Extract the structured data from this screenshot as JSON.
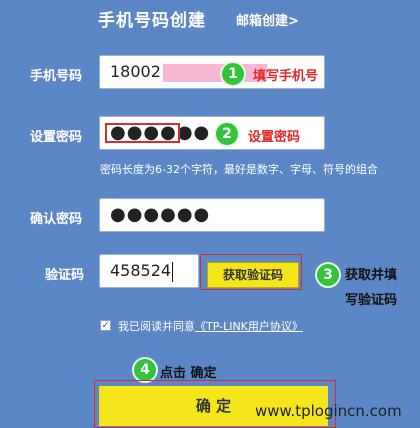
{
  "header": {
    "title": "手机号码创建",
    "alt_link": "邮箱创建>"
  },
  "phone": {
    "label": "手机号码",
    "value": "18002",
    "step": "1",
    "annotation": "填写手机号"
  },
  "password": {
    "label": "设置密码",
    "value": "●●●●●●",
    "step": "2",
    "annotation": "设置密码",
    "hint": "密码长度为6-32个字符，最好是数字、字母、符号的组合"
  },
  "confirm": {
    "label": "确认密码",
    "value": "●●●●●●"
  },
  "captcha": {
    "label": "验证码",
    "value": "458524",
    "button": "获取验证码",
    "step": "3",
    "annotation_line1": "获取并填",
    "annotation_line2": "写验证码"
  },
  "agreement": {
    "checked_mark": "✓",
    "text_prefix": "我已阅读并同意",
    "link": "《TP-LINK用户协议》"
  },
  "submit": {
    "step": "4",
    "annotation": "点击 确定",
    "label": "确 定"
  },
  "watermark": "www.tplogincn.com",
  "colors": {
    "background": "#5b87c6",
    "accent_yellow": "#f5e61c",
    "badge_green": "#33c43b",
    "annotation_red": "#e32727"
  }
}
